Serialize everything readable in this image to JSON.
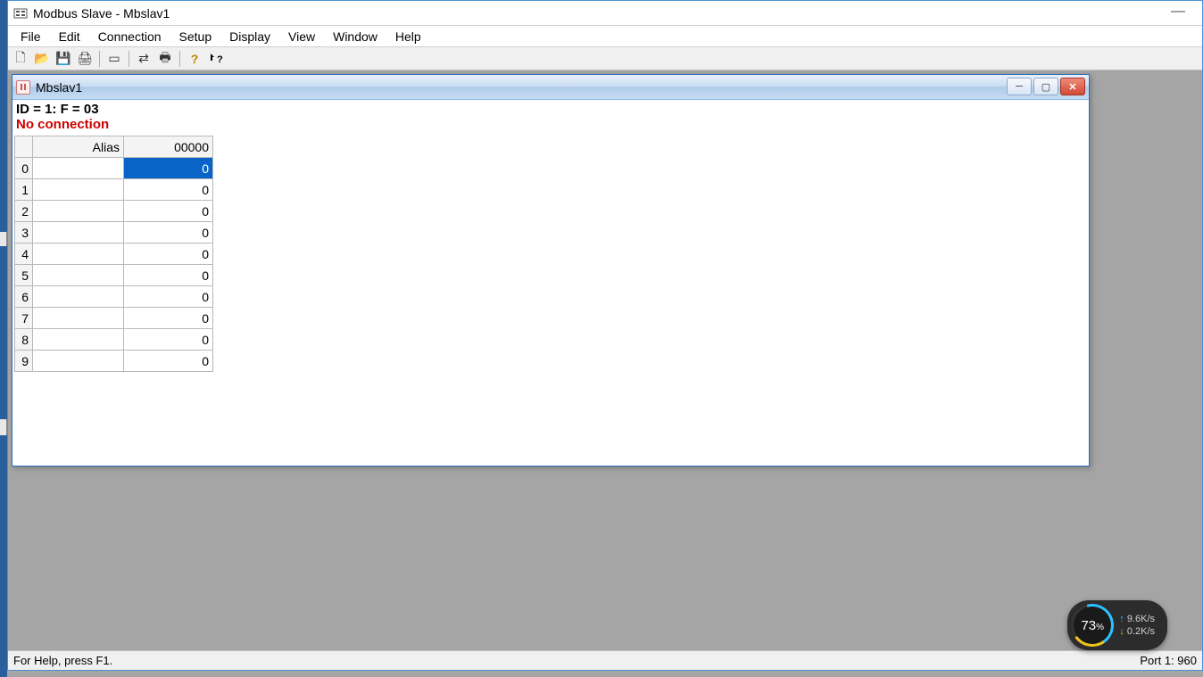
{
  "app": {
    "title": "Modbus Slave - Mbslav1",
    "minimize_glyph": "—"
  },
  "menu": {
    "items": [
      "File",
      "Edit",
      "Connection",
      "Setup",
      "Display",
      "View",
      "Window",
      "Help"
    ]
  },
  "toolbar": {
    "new": "🗋",
    "open": "📂",
    "save": "💾",
    "print": "🖨",
    "window": "▭",
    "comm1": "⇄",
    "comm2": "🖶",
    "help": "?",
    "whatsthis": "⁇"
  },
  "child": {
    "title": "Mbslav1",
    "min_glyph": "─",
    "max_glyph": "▢",
    "close_glyph": "✕",
    "id_line": "ID = 1: F = 03",
    "status_line": "No connection",
    "headers": {
      "alias": "Alias",
      "addr": "00000"
    },
    "rows": [
      {
        "idx": "0",
        "alias": "",
        "val": "0",
        "selected": true
      },
      {
        "idx": "1",
        "alias": "",
        "val": "0",
        "selected": false
      },
      {
        "idx": "2",
        "alias": "",
        "val": "0",
        "selected": false
      },
      {
        "idx": "3",
        "alias": "",
        "val": "0",
        "selected": false
      },
      {
        "idx": "4",
        "alias": "",
        "val": "0",
        "selected": false
      },
      {
        "idx": "5",
        "alias": "",
        "val": "0",
        "selected": false
      },
      {
        "idx": "6",
        "alias": "",
        "val": "0",
        "selected": false
      },
      {
        "idx": "7",
        "alias": "",
        "val": "0",
        "selected": false
      },
      {
        "idx": "8",
        "alias": "",
        "val": "0",
        "selected": false
      },
      {
        "idx": "9",
        "alias": "",
        "val": "0",
        "selected": false
      }
    ]
  },
  "status": {
    "help": "For Help, press F1.",
    "port": "Port 1: 960"
  },
  "netwidget": {
    "percent": "73",
    "percent_suffix": "%",
    "up": "9.6K/s",
    "down": "0.2K/s"
  }
}
